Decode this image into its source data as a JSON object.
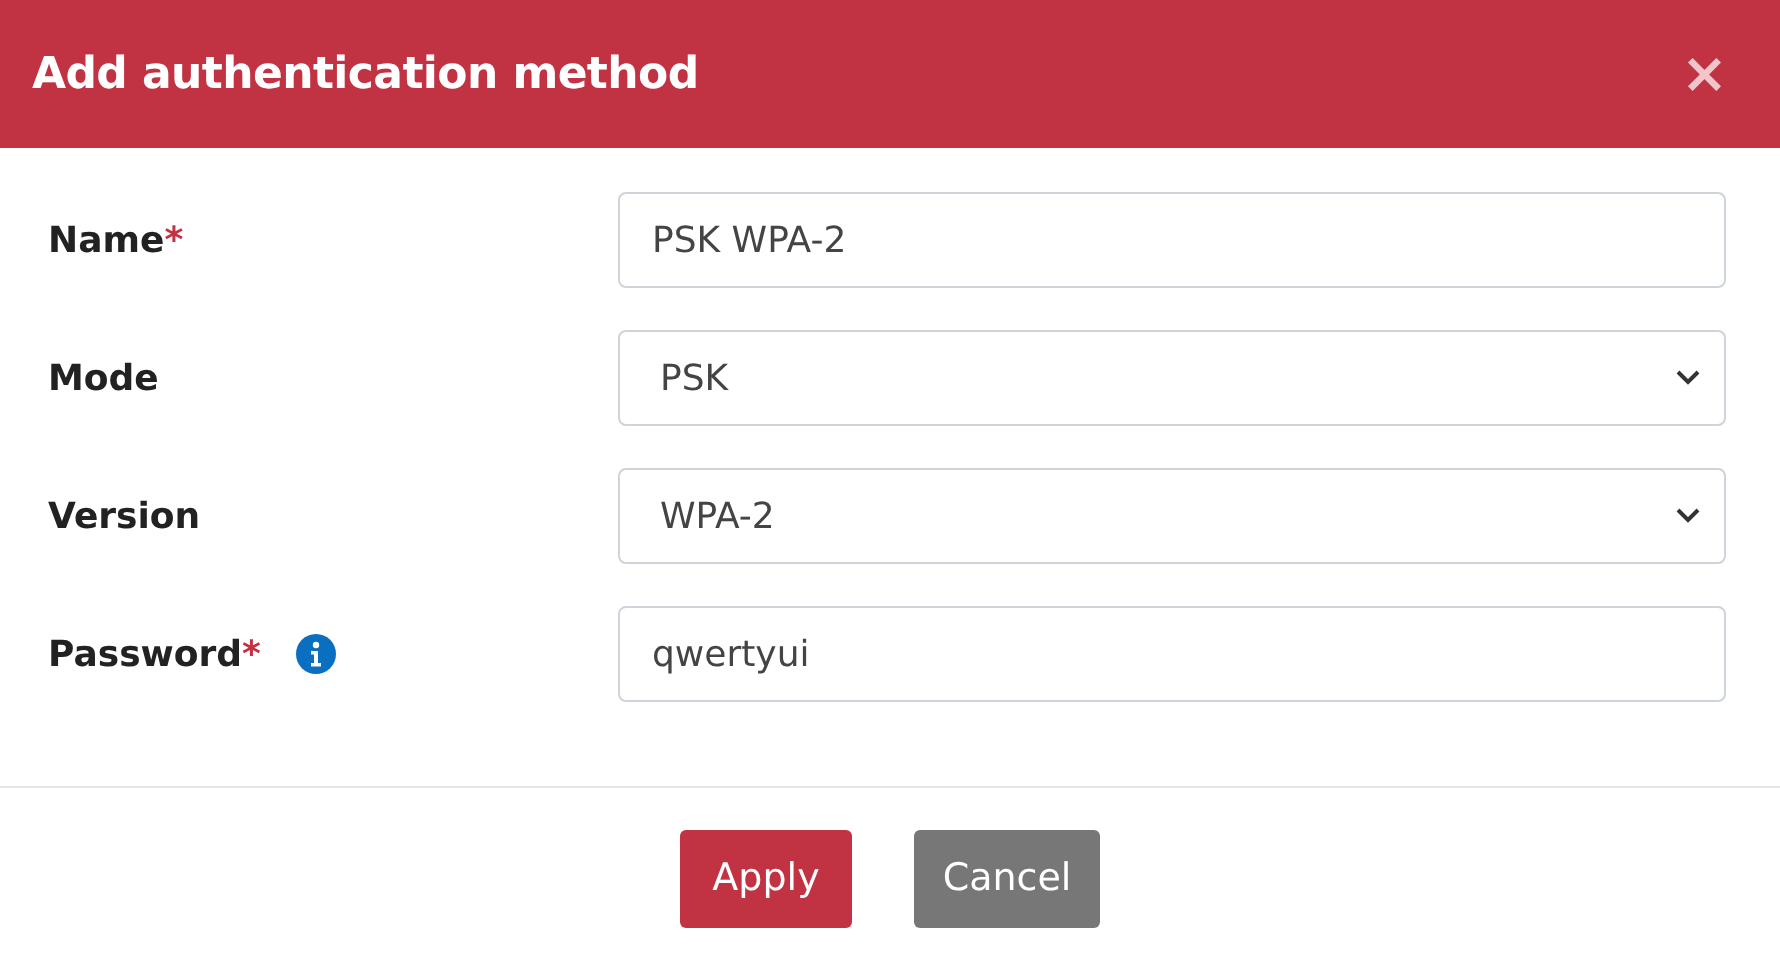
{
  "dialog": {
    "title": "Add authentication method",
    "close": "×"
  },
  "fields": [
    {
      "kind": "text",
      "label": "Name",
      "required_mark": "*",
      "value": "PSK WPA-2",
      "info": false
    },
    {
      "kind": "select",
      "label": "Mode",
      "value": "PSK",
      "info": false
    },
    {
      "kind": "select",
      "label": "Version",
      "value": "WPA-2",
      "info": false
    },
    {
      "kind": "text",
      "label": "Password",
      "required_mark": "*",
      "value": "qwertyui",
      "info": true
    }
  ],
  "buttons": [
    {
      "kind": "primary",
      "label": "Apply"
    },
    {
      "kind": "secondary",
      "label": "Cancel"
    }
  ]
}
